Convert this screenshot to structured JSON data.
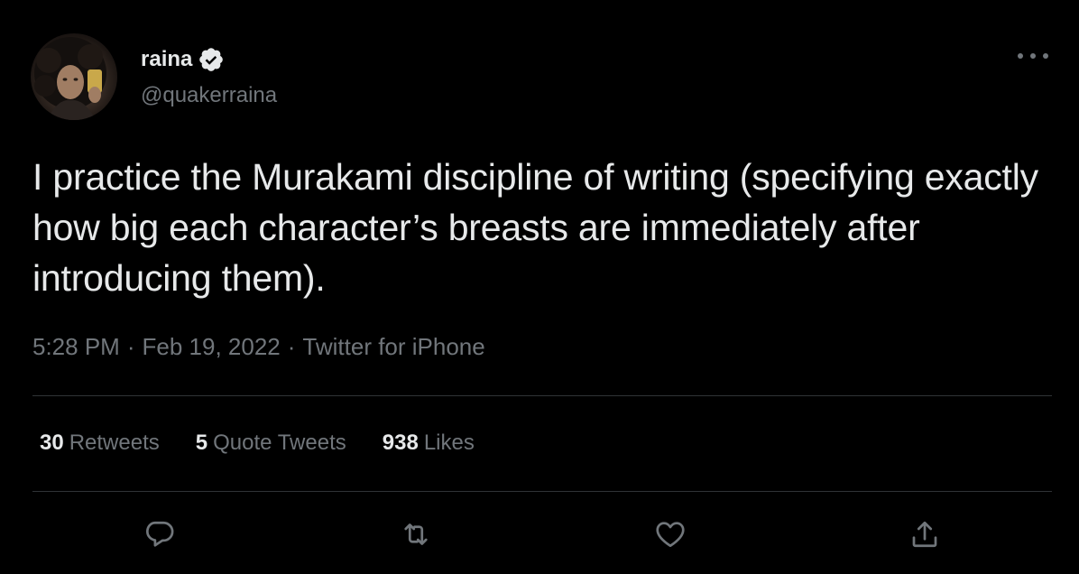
{
  "author": {
    "display_name": "raina",
    "handle": "@quakerraina",
    "verified_icon": "verified-badge-icon",
    "avatar_icon": "profile-photo"
  },
  "tweet": {
    "text": "I practice the Murakami discipline of writing (specifying exactly how big each character’s breasts are immediately after introducing them).",
    "time": "5:28 PM",
    "separator": "·",
    "date": "Feb 19, 2022",
    "source": "Twitter for iPhone"
  },
  "stats": {
    "retweets_count": "30",
    "retweets_label": "Retweets",
    "quotes_count": "5",
    "quotes_label": "Quote Tweets",
    "likes_count": "938",
    "likes_label": "Likes"
  },
  "actions": [
    "reply-icon",
    "retweet-icon",
    "like-icon",
    "share-icon"
  ],
  "colors": {
    "background": "#000000",
    "text_primary": "#e7e9ea",
    "text_secondary": "#71767b",
    "divider": "#2f3336"
  }
}
